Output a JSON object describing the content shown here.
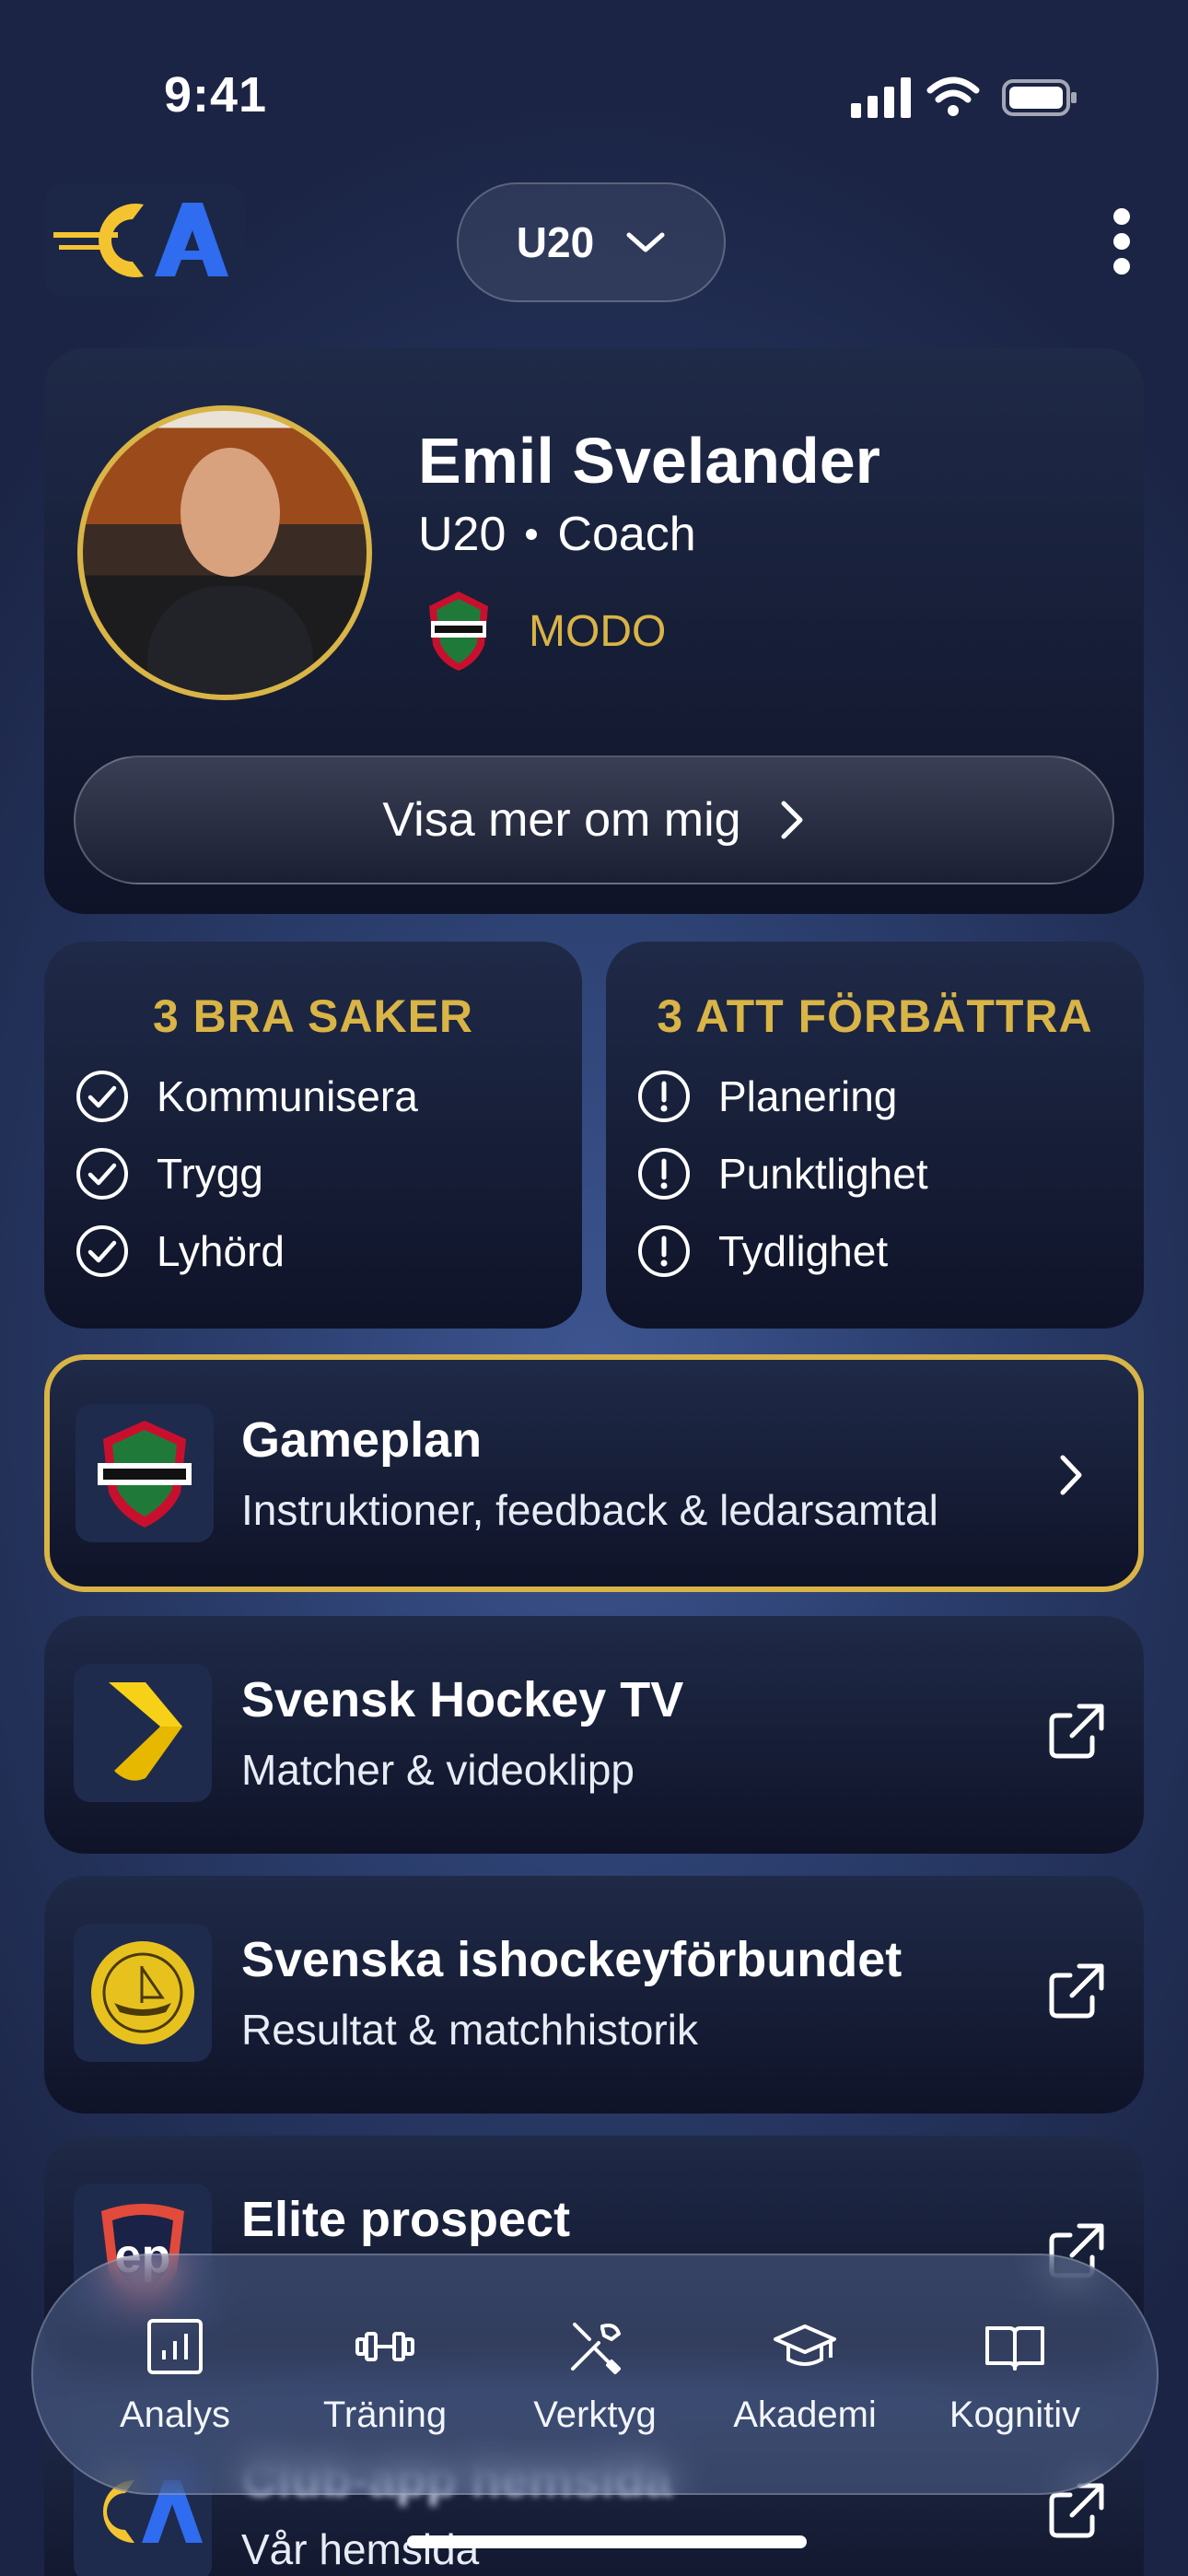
{
  "status_bar": {
    "time": "9:41"
  },
  "header": {
    "team_selector": "U20"
  },
  "profile": {
    "name": "Emil Svelander",
    "team": "U20",
    "role": "Coach",
    "club": "MODO",
    "about_button": "Visa mer om mig"
  },
  "strengths": {
    "heading": "3 BRA SAKER",
    "items": [
      "Kommunisera",
      "Trygg",
      "Lyhörd"
    ]
  },
  "improvements": {
    "heading": "3 ATT FÖRBÄTTRA",
    "items": [
      "Planering",
      "Punktlighet",
      "Tydlighet"
    ]
  },
  "links": [
    {
      "title": "Gameplan",
      "subtitle": "Instruktioner, feedback & ledarsamtal"
    },
    {
      "title": "Svensk Hockey TV",
      "subtitle": "Matcher & videoklipp"
    },
    {
      "title": "Svenska ishockeyförbundet",
      "subtitle": "Resultat & matchhistorik"
    },
    {
      "title": "Elite prospect",
      "subtitle": ""
    },
    {
      "title": "Club-app hemsida",
      "subtitle": "Vår hemsida"
    }
  ],
  "bottom_nav": [
    {
      "label": "Analys",
      "icon": "chart-icon"
    },
    {
      "label": "Träning",
      "icon": "dumbbell-icon"
    },
    {
      "label": "Verktyg",
      "icon": "tools-icon"
    },
    {
      "label": "Akademi",
      "icon": "graduation-cap-icon"
    },
    {
      "label": "Kognitiv",
      "icon": "book-icon"
    }
  ],
  "colors": {
    "accent_gold": "#d9b446",
    "background": "#2a3d6c",
    "card": "#161d36"
  }
}
